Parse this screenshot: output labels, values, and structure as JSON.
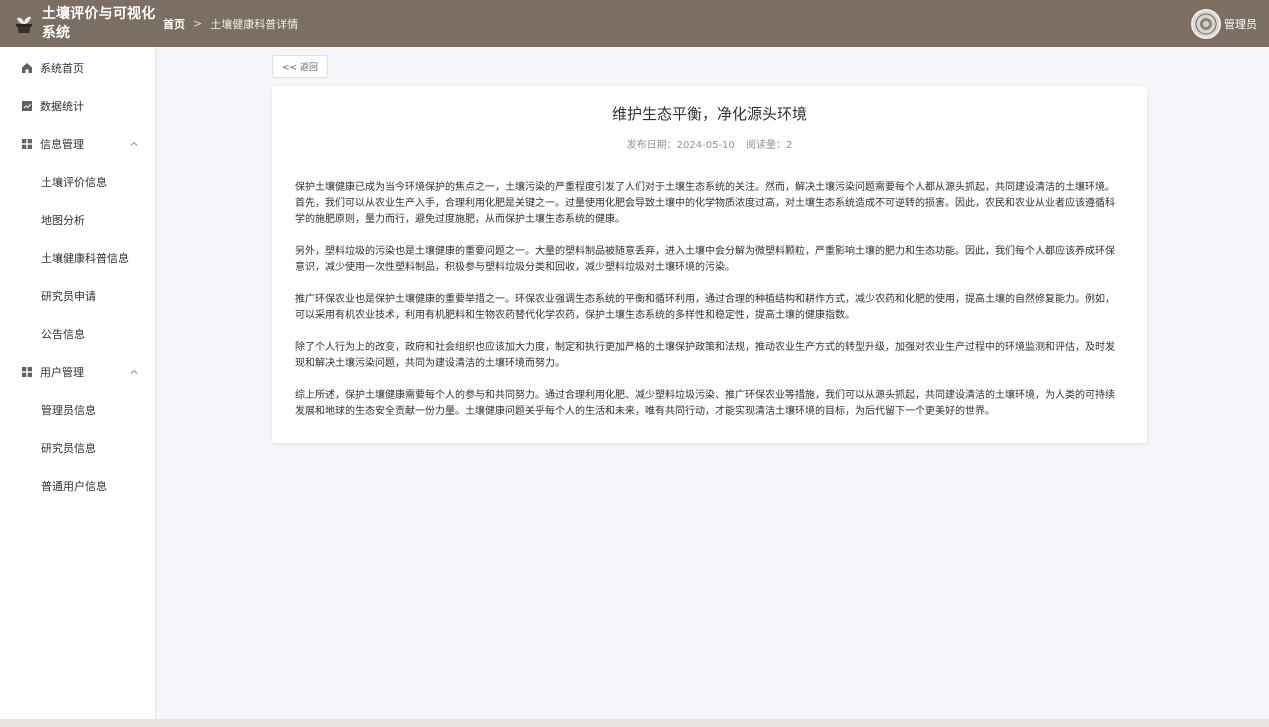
{
  "header": {
    "app_title": "土壤评价与可视化系统",
    "breadcrumb_home": "首页",
    "breadcrumb_sep": ">",
    "breadcrumb_current": "土壤健康科普详情",
    "user_name": "管理员"
  },
  "sidebar": {
    "items": [
      {
        "label": "系统首页",
        "icon": "home-icon"
      },
      {
        "label": "数据统计",
        "icon": "chart-icon"
      },
      {
        "label": "信息管理",
        "icon": "grid-icon",
        "expanded": true,
        "children": [
          "土壤评价信息",
          "地图分析",
          "土壤健康科普信息",
          "研究员申请",
          "公告信息"
        ]
      },
      {
        "label": "用户管理",
        "icon": "grid-icon",
        "expanded": true,
        "children": [
          "管理员信息",
          "研究员信息",
          "普通用户信息"
        ]
      }
    ]
  },
  "main": {
    "back_label": "<< 返回",
    "article": {
      "title": "维护生态平衡，净化源头环境",
      "date_label": "发布日期：2024-05-10",
      "views_label": "阅读量：2",
      "paragraphs": [
        "保护土壤健康已成为当今环境保护的焦点之一，土壤污染的严重程度引发了人们对于土壤生态系统的关注。然而，解决土壤污染问题需要每个人都从源头抓起，共同建设清洁的土壤环境。首先，我们可以从农业生产入手，合理利用化肥是关键之一。过量使用化肥会导致土壤中的化学物质浓度过高，对土壤生态系统造成不可逆转的损害。因此，农民和农业从业者应该遵循科学的施肥原则，量力而行，避免过度施肥，从而保护土壤生态系统的健康。",
        "另外，塑料垃圾的污染也是土壤健康的重要问题之一。大量的塑料制品被随意丢弃，进入土壤中会分解为微塑料颗粒，严重影响土壤的肥力和生态功能。因此，我们每个人都应该养成环保意识，减少使用一次性塑料制品，积极参与塑料垃圾分类和回收，减少塑料垃圾对土壤环境的污染。",
        "推广环保农业也是保护土壤健康的重要举措之一。环保农业强调生态系统的平衡和循环利用，通过合理的种植结构和耕作方式，减少农药和化肥的使用，提高土壤的自然修复能力。例如，可以采用有机农业技术，利用有机肥料和生物农药替代化学农药，保护土壤生态系统的多样性和稳定性，提高土壤的健康指数。",
        "除了个人行为上的改变，政府和社会组织也应该加大力度，制定和执行更加严格的土壤保护政策和法规，推动农业生产方式的转型升级，加强对农业生产过程中的环境监测和评估，及时发现和解决土壤污染问题，共同为建设清洁的土壤环境而努力。",
        "综上所述，保护土壤健康需要每个人的参与和共同努力。通过合理利用化肥、减少塑料垃圾污染、推广环保农业等措施，我们可以从源头抓起，共同建设清洁的土壤环境，为人类的可持续发展和地球的生态安全贡献一份力量。土壤健康问题关乎每个人的生活和未来，唯有共同行动，才能实现清洁土壤环境的目标，为后代留下一个更美好的世界。"
      ]
    }
  },
  "colors": {
    "topbar": "#7a6f62",
    "sidebar_bg": "#ffffff",
    "page_bg": "#f5f6fa"
  }
}
